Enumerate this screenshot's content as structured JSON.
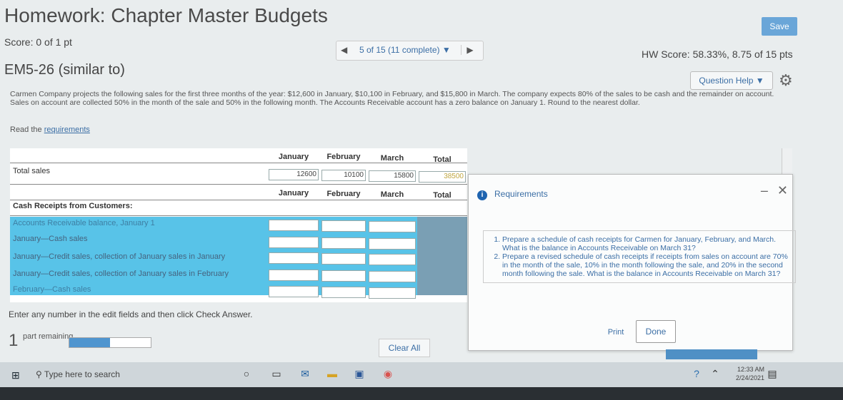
{
  "header": {
    "title": "Homework: Chapter Master Budgets",
    "save_label": "Save",
    "score": "Score: 0 of 1 pt",
    "nav_label": "5 of 15 (11 complete) ▼",
    "hw_score": "HW Score: 58.33%, 8.75 of 15 pts",
    "question_name": "EM5-26 (similar to)",
    "question_help": "Question Help ▼"
  },
  "problem": {
    "text": "Carmen Company projects the following sales for the first three months of the year: $12,600 in January, $10,100 in February, and $15,800 in March. The company expects 80% of the sales to be cash and the remainder on account. Sales on account are collected 50% in the month of the sale and 50% in the following month. The Accounts Receivable account has a zero balance on January 1. Round to the nearest dollar.",
    "read_prefix": "Read the",
    "read_link": "requirements"
  },
  "table": {
    "months": [
      "January",
      "February",
      "March",
      "Total"
    ],
    "total_sales_label": "Total sales",
    "total_sales": [
      "12600",
      "10100",
      "15800",
      "38500"
    ],
    "section_label": "Cash Receipts from Customers:",
    "rows": [
      "Accounts Receivable balance, January 1",
      "January—Cash sales",
      "January—Credit sales, collection of January sales in January",
      "January—Credit sales, collection of January sales in February",
      "February—Cash sales"
    ]
  },
  "footer": {
    "enter_text": "Enter any number in the edit fields and then click Check Answer.",
    "part_number": "1",
    "part_text": "part remaining",
    "progress": 0.5,
    "clear_all": "Clear All"
  },
  "modal": {
    "title": "Requirements",
    "items": [
      "Prepare a schedule of cash receipts for Carmen for January, February, and March. What is the balance in Accounts Receivable on March 31?",
      "Prepare a revised schedule of cash receipts if receipts from sales on account are 70% in the month of the sale, 10% in the month following the sale, and 20% in the second month following the sale. What is the balance in Accounts Receivable on March 31?"
    ],
    "print": "Print",
    "done": "Done"
  },
  "taskbar": {
    "search": "Type here to search",
    "time": "12:33 AM",
    "date": "2/24/2021"
  },
  "colors": {
    "row_highlight": "#58c3e8",
    "accent": "#3b6ea5"
  }
}
